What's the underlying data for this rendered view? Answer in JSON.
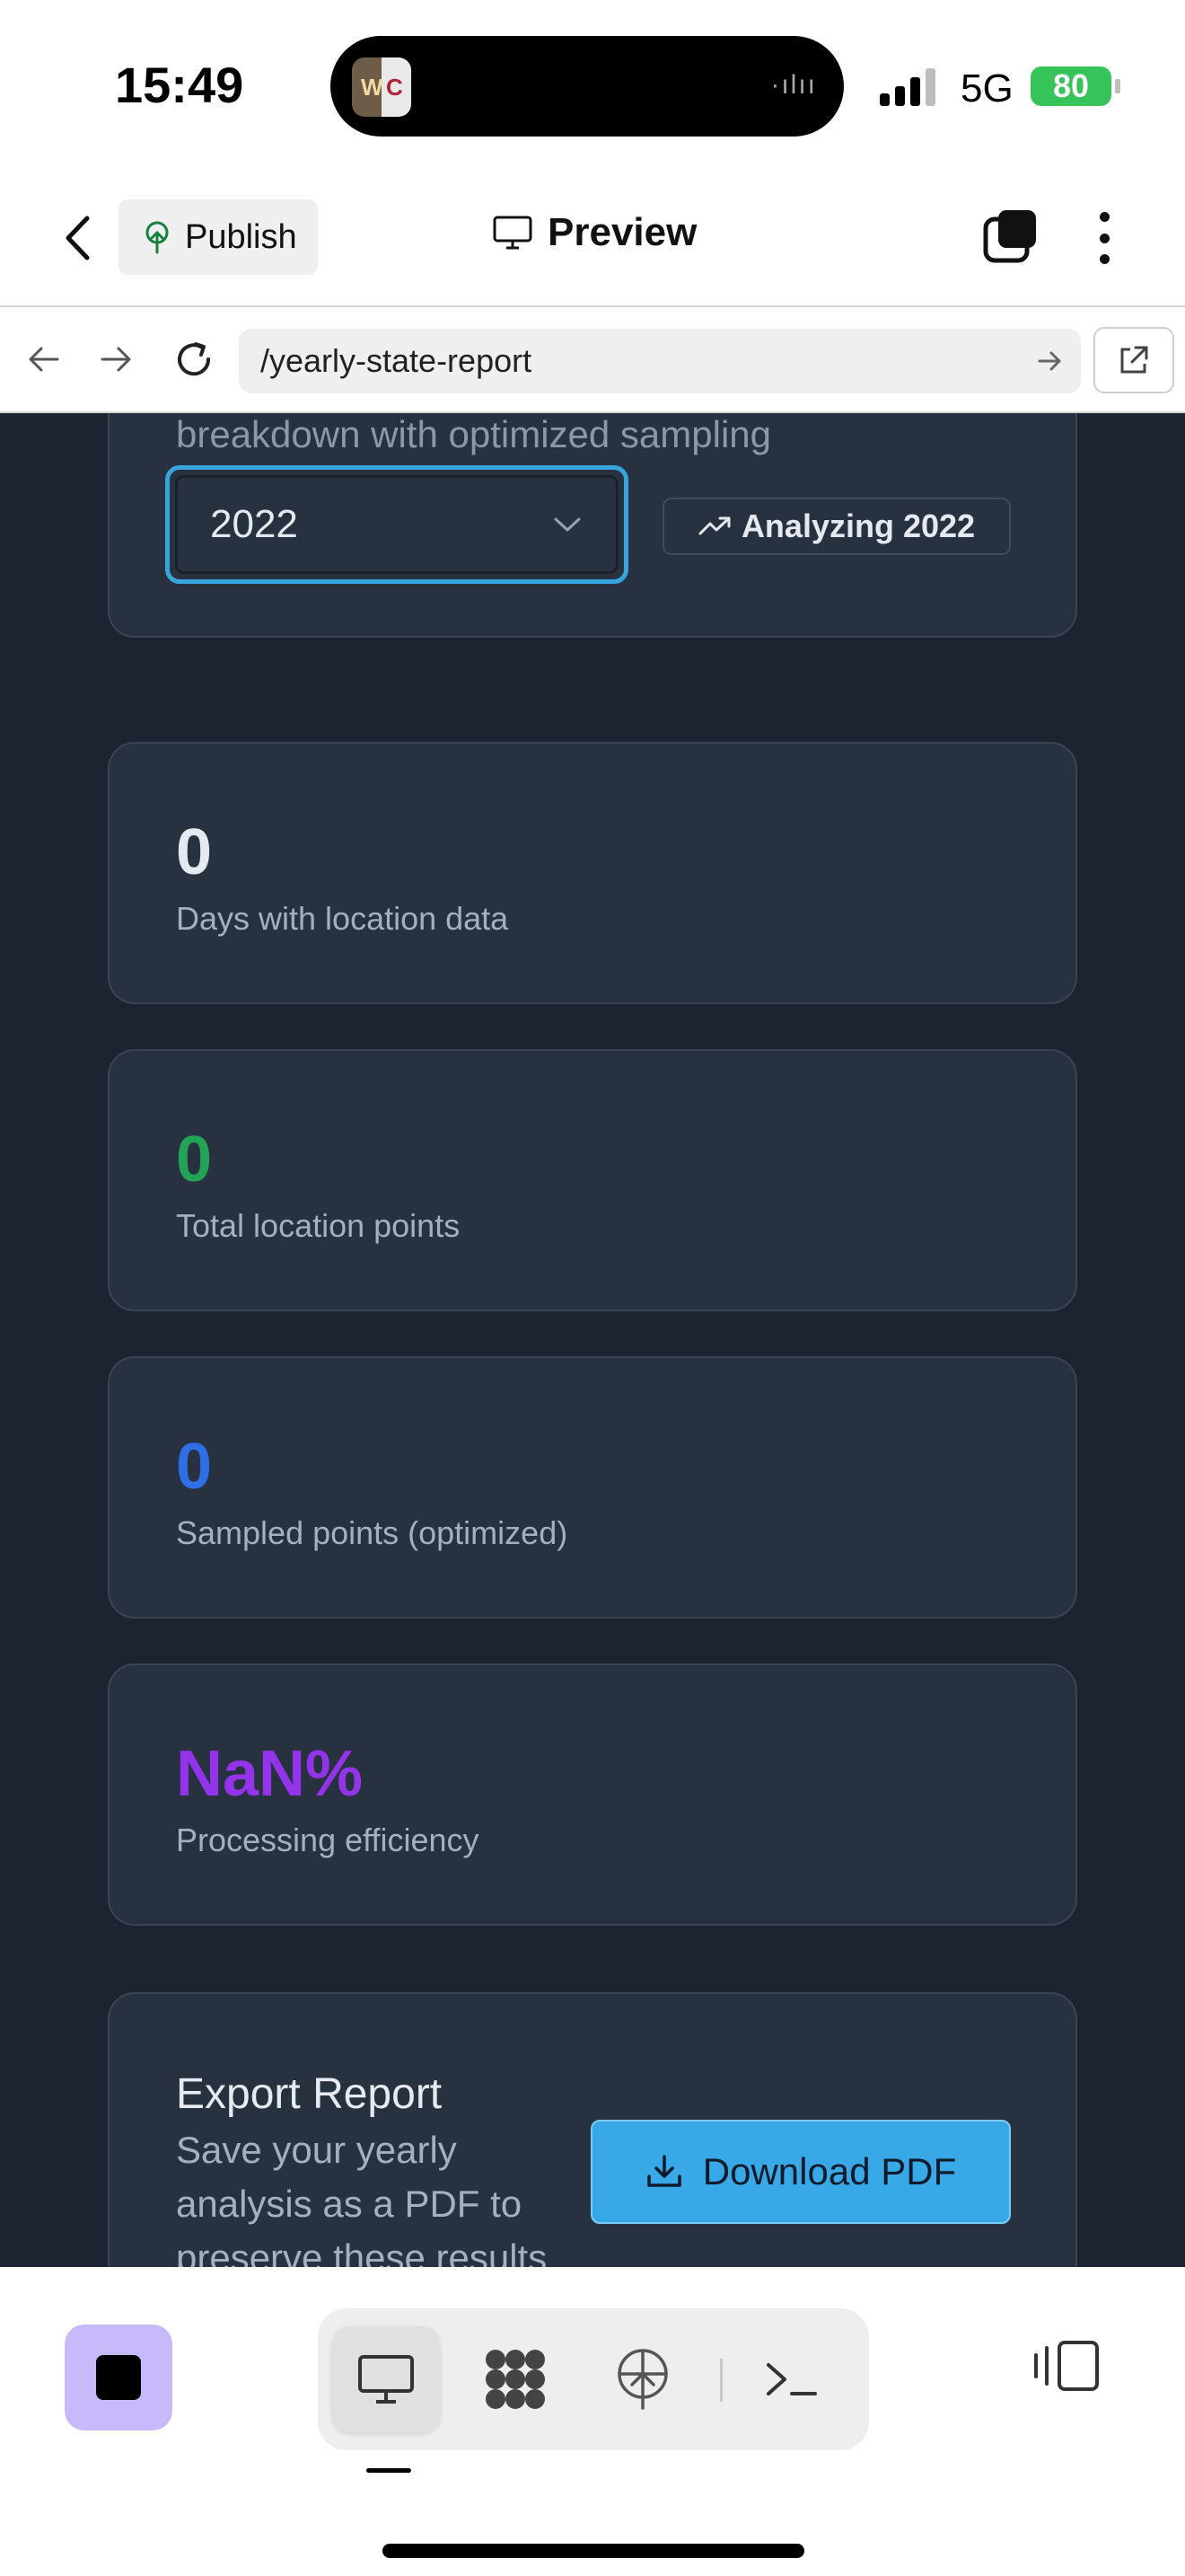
{
  "status_bar": {
    "time": "15:49",
    "network": "5G",
    "battery": "80",
    "signal_bars": 3
  },
  "toolbar": {
    "publish_label": "Publish",
    "preview_label": "Preview"
  },
  "url_bar": {
    "url": "/yearly-state-report"
  },
  "header_card": {
    "subtitle": "breakdown with optimized sampling",
    "selected_year": "2022",
    "badge_label": "Analyzing 2022"
  },
  "stats": [
    {
      "value": "0",
      "label": "Days with location data",
      "color": "#e5e9f0"
    },
    {
      "value": "0",
      "label": "Total location points",
      "color": "#22a355"
    },
    {
      "value": "0",
      "label": "Sampled points (optimized)",
      "color": "#2e6fe6"
    },
    {
      "value": "NaN%",
      "label": "Processing efficiency",
      "color": "#9333ea"
    }
  ],
  "export": {
    "title": "Export Report",
    "description": "Save your yearly analysis as a PDF to preserve these results",
    "button_label": "Download PDF"
  },
  "colors": {
    "page_bg": "#1c2331",
    "card_bg": "#283140",
    "accent": "#38a8e6",
    "stop_button": "#c8b9fb"
  },
  "icons": [
    "back-chevron-icon",
    "publish-tree-icon",
    "monitor-icon",
    "tabs-icon",
    "more-vertical-icon",
    "arrow-left-icon",
    "arrow-right-icon",
    "reload-icon",
    "go-arrow-icon",
    "external-link-icon",
    "chevron-down-icon",
    "trending-up-icon",
    "download-icon",
    "stop-icon",
    "desktop-icon",
    "grid-blob-icon",
    "tree-upload-icon",
    "terminal-icon",
    "layout-toggle-icon"
  ]
}
